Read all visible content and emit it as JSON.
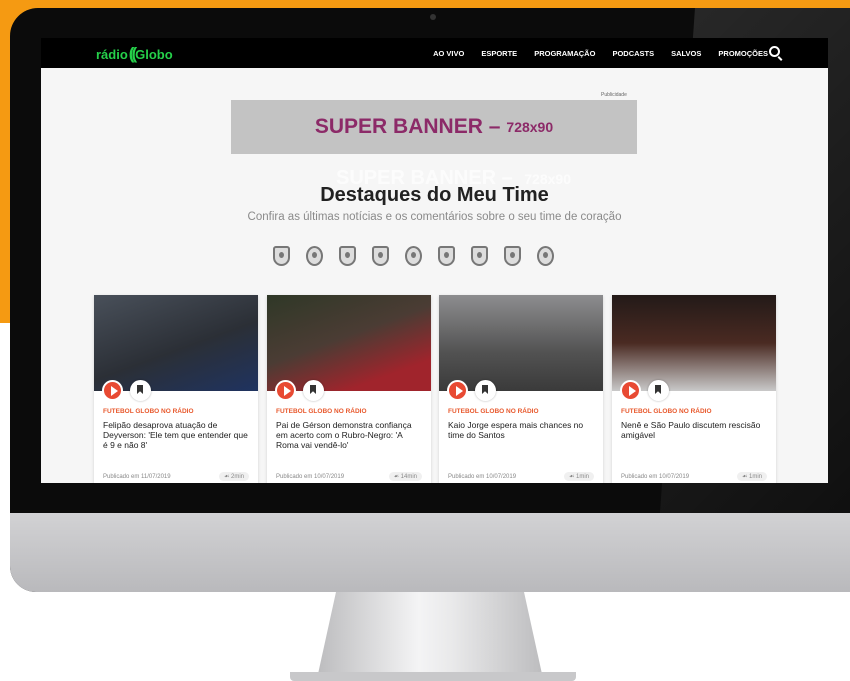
{
  "nav": {
    "logo_text": "rádio",
    "logo_mark": "((",
    "logo_brand": "Globo",
    "items": [
      "AO VIVO",
      "ESPORTE",
      "PROGRAMAÇÃO",
      "PODCASTS",
      "SALVOS",
      "PROMOÇÕES"
    ]
  },
  "ad": {
    "label": "Publicidade",
    "banner_main": "SUPER BANNER –",
    "banner_size": "728x90"
  },
  "section": {
    "title": "Destaques do Meu Time",
    "subtitle": "Confira as últimas notícias e os comentários sobre o seu time de coração"
  },
  "teams": [
    "botafogo-crest-icon",
    "corinthians-crest-icon",
    "flamengo-crest-icon",
    "fluminense-crest-icon",
    "palmeiras-crest-icon",
    "santos-crest-icon",
    "sao-paulo-crest-icon",
    "vasco-crest-icon",
    "brasil-crest-icon"
  ],
  "cards": [
    {
      "category": "FUTEBOL GLOBO NO RÁDIO",
      "headline": "Felipão desaprova atuação de Deyverson: 'Ele tem que entender que é 9 e não 8'",
      "date": "Publicado em 11/07/2019",
      "duration": "2min"
    },
    {
      "category": "FUTEBOL GLOBO NO RÁDIO",
      "headline": "Pai de Gérson demonstra confiança em acerto com o Rubro-Negro: 'A Roma vai vendê-lo'",
      "date": "Publicado em 10/07/2019",
      "duration": "14min"
    },
    {
      "category": "FUTEBOL GLOBO NO RÁDIO",
      "headline": "Kaio Jorge espera mais chances no time do Santos",
      "date": "Publicado em 10/07/2019",
      "duration": "1min"
    },
    {
      "category": "FUTEBOL GLOBO NO RÁDIO",
      "headline": "Nenê e São Paulo discutem rescisão amigável",
      "date": "Publicado em 10/07/2019",
      "duration": "1min"
    }
  ],
  "colors": {
    "accent": "#e84a33",
    "brand_green": "#25d04a",
    "background_orange": "#f59a12",
    "banner_text": "#8c2a68"
  }
}
